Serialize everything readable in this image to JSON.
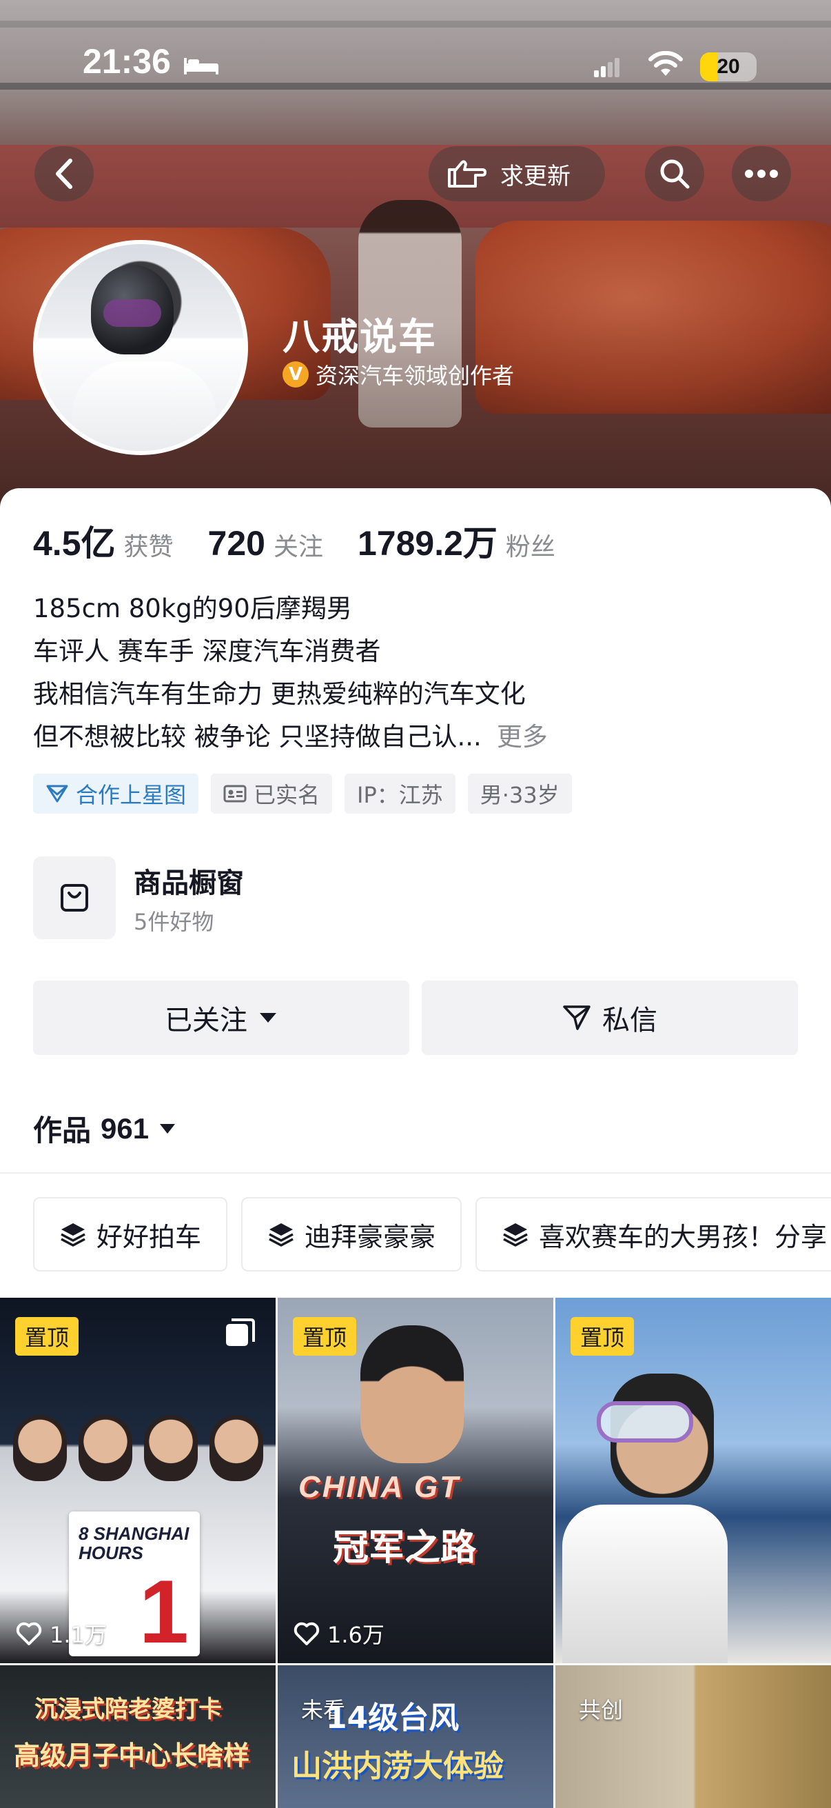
{
  "status_bar": {
    "time": "21:36",
    "battery": "20"
  },
  "nav": {
    "request_update_label": "求更新"
  },
  "profile": {
    "name": "八戒说车",
    "certification": "资深汽车领域创作者",
    "cert_badge": "V"
  },
  "stats": {
    "likes_value": "4.5亿",
    "likes_label": "获赞",
    "following_value": "720",
    "following_label": "关注",
    "followers_value": "1789.2万",
    "followers_label": "粉丝"
  },
  "bio": {
    "lines": [
      "185cm 80kg的90后摩羯男",
      "车评人 赛车手 深度汽车消费者",
      "我相信汽车有生命力  更热爱纯粹的汽车文化",
      "但不想被比较 被争论  只坚持做自己认..."
    ],
    "more": "更多"
  },
  "tags": [
    {
      "label": "合作上星图"
    },
    {
      "label": "已实名"
    },
    {
      "label": "IP：江苏"
    },
    {
      "label": "男·33岁"
    }
  ],
  "shop": {
    "title": "商品橱窗",
    "subtitle": "5件好物"
  },
  "actions": {
    "follow_label": "已关注",
    "message_label": "私信"
  },
  "works": {
    "label": "作品",
    "count": "961"
  },
  "collections": [
    {
      "label": "好好拍车"
    },
    {
      "label": "迪拜豪豪豪"
    },
    {
      "label": "喜欢赛车的大男孩！分享"
    }
  ],
  "videos": [
    {
      "pin": "置顶",
      "likes": "1.1万",
      "sign_text": "8 SHANGHAI HOURS",
      "sign_num": "1"
    },
    {
      "pin": "置顶",
      "likes": "1.6万",
      "title": "CHINA GT",
      "subtitle": "冠军之路"
    },
    {
      "pin": "置顶"
    },
    {
      "line1": "沉浸式陪老婆打卡",
      "line2": "高级月子中心长啥样"
    },
    {
      "badge": "未看",
      "line1": "14级台风",
      "line2": "山洪内涝大体验"
    },
    {
      "badge": "共创"
    }
  ],
  "colors": {
    "accent_pin": "#fed12f",
    "text_primary": "#161823",
    "text_secondary": "#8a8b91",
    "tag_blue": "#2c7bc0",
    "cert_gold": "#f5a623"
  }
}
